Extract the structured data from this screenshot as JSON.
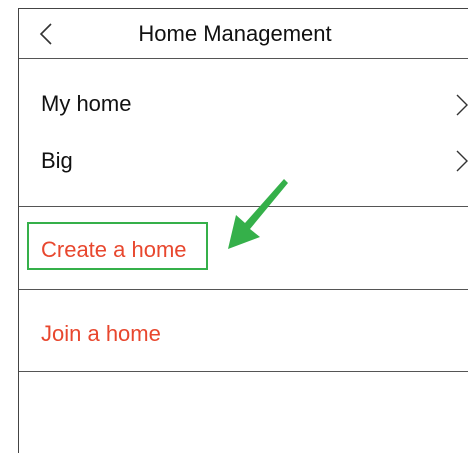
{
  "header": {
    "title": "Home Management",
    "back_icon": "chevron-left-icon"
  },
  "homes": [
    {
      "label": "My home",
      "icon": "chevron-right-icon"
    },
    {
      "label": "Big",
      "icon": "chevron-right-icon"
    }
  ],
  "actions": {
    "create": "Create a home",
    "join": "Join a home"
  },
  "colors": {
    "action_text": "#e8472e",
    "highlight": "#35b04a",
    "divider": "#555555"
  }
}
